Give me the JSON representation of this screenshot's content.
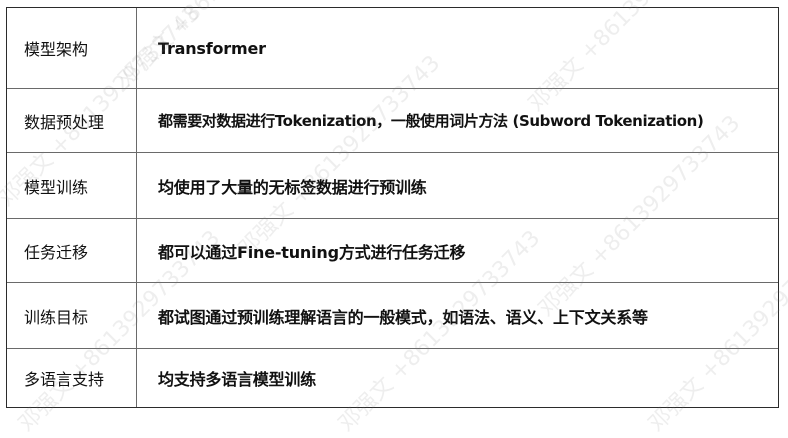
{
  "rows": [
    {
      "label": "模型架构",
      "value": "Transformer"
    },
    {
      "label": "数据预处理",
      "value": "都需要对数据进行Tokenization，一般使用词片方法 (Subword Tokenization)"
    },
    {
      "label": "模型训练",
      "value": "均使用了大量的无标签数据进行预训练"
    },
    {
      "label": "任务迁移",
      "value": "都可以通过Fine-tuning方式进行任务迁移"
    },
    {
      "label": "训练目标",
      "value": "都试图通过预训练理解语言的一般模式，如语法、语义、上下文关系等"
    },
    {
      "label": "多语言支持",
      "value": "均支持多语言模型训练"
    }
  ],
  "watermark": "邓强文 +8613929733743"
}
